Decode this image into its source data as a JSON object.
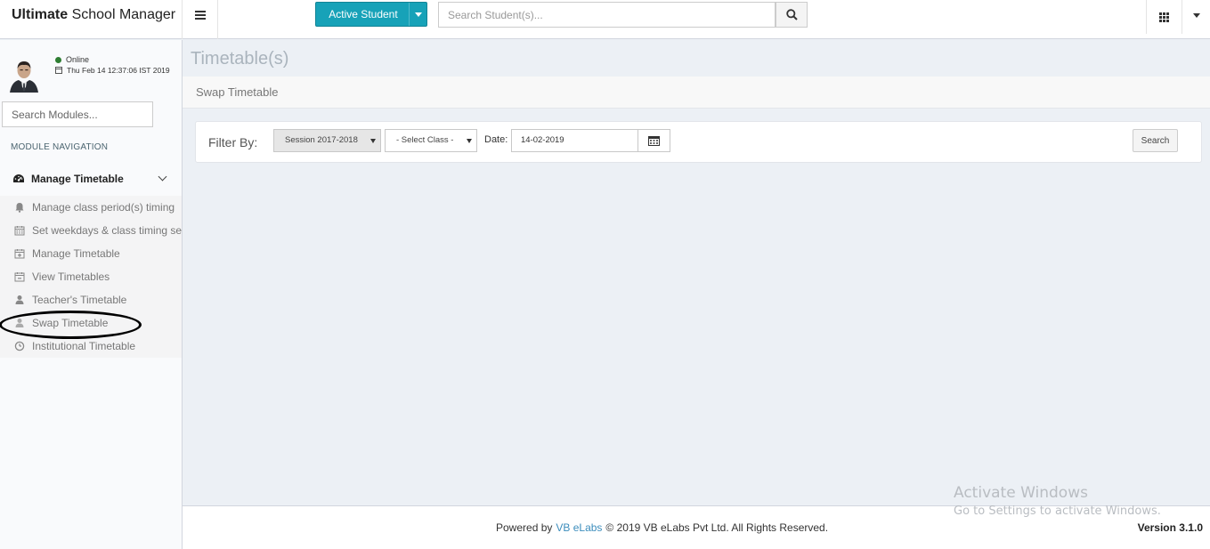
{
  "app": {
    "brand_bold": "Ultimate",
    "brand_rest": " School Manager"
  },
  "header": {
    "active_student_label": "Active Student",
    "student_search_placeholder": "Search Student(s)..."
  },
  "user": {
    "status": "Online",
    "datetime": "Thu Feb 14 12:37:06 IST 2019"
  },
  "sidebar": {
    "module_search_placeholder": "Search Modules...",
    "nav_header": "MODULE NAVIGATION",
    "parent_label": "Manage Timetable",
    "items": [
      {
        "label": "Manage class period(s) timing",
        "icon": "bell-icon"
      },
      {
        "label": "Set weekdays & class timing sets",
        "icon": "calendar-icon"
      },
      {
        "label": "Manage Timetable",
        "icon": "calendar-plus-icon"
      },
      {
        "label": "View Timetables",
        "icon": "calendar-minus-icon"
      },
      {
        "label": "Teacher's Timetable",
        "icon": "user-icon"
      },
      {
        "label": "Swap Timetable",
        "icon": "user-icon"
      },
      {
        "label": "Institutional Timetable",
        "icon": "clock-icon"
      }
    ]
  },
  "content": {
    "page_title": "Timetable(s)",
    "breadcrumb": "Swap Timetable",
    "filter": {
      "label": "Filter By:",
      "session_value": "Session 2017-2018",
      "class_value": "- Select Class -",
      "date_label": "Date:",
      "date_value": "14-02-2019",
      "search_label": "Search"
    }
  },
  "footer": {
    "powered_by": "Powered by",
    "company_link": "VB eLabs",
    "copyright": "© 2019 VB eLabs Pvt Ltd. All Rights Reserved.",
    "version": "Version 3.1.0"
  },
  "watermark": {
    "line1": "Activate Windows",
    "line2": "Go to Settings to activate Windows."
  },
  "colors": {
    "accent": "#17a2b8",
    "link": "#3c8dbc",
    "online": "#2e7d32"
  }
}
